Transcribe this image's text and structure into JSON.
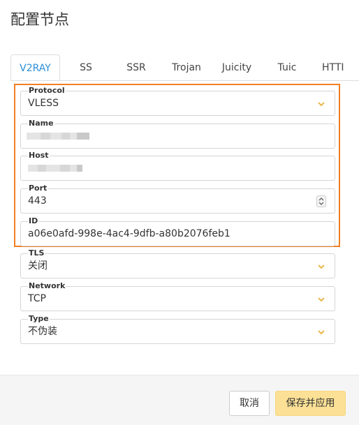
{
  "dialog": {
    "title": "配置节点"
  },
  "tabs": [
    {
      "label": "V2RAY",
      "active": true
    },
    {
      "label": "SS"
    },
    {
      "label": "SSR"
    },
    {
      "label": "Trojan"
    },
    {
      "label": "Juicity"
    },
    {
      "label": "Tuic"
    },
    {
      "label": "HTTI"
    }
  ],
  "form": {
    "protocol": {
      "label": "Protocol",
      "value": "VLESS"
    },
    "name": {
      "label": "Name",
      "value": ""
    },
    "host": {
      "label": "Host",
      "value": ""
    },
    "port": {
      "label": "Port",
      "value": "443"
    },
    "id": {
      "label": "ID",
      "value": "a06e0afd-998e-4ac4-9dfb-a80b2076feb1"
    },
    "tls": {
      "label": "TLS",
      "value": "关闭"
    },
    "network": {
      "label": "Network",
      "value": "TCP"
    },
    "type": {
      "label": "Type",
      "value": "不伪装"
    }
  },
  "footer": {
    "cancel_label": "取消",
    "save_label": "保存并应用"
  },
  "colors": {
    "accent": "#2b8fd9",
    "highlight": "#f07f23",
    "save_button": "#fbe095",
    "chevron": "#e8b84a"
  },
  "icons": {
    "select": "chevron-down-icon",
    "stepper": "spinner-icon"
  }
}
